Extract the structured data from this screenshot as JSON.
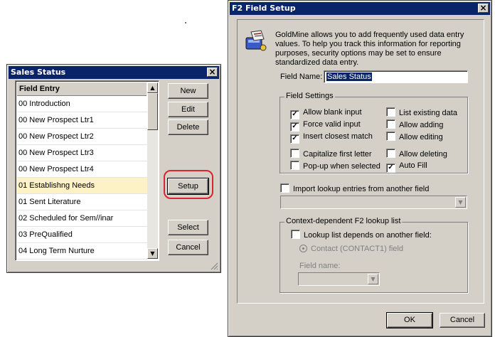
{
  "sales_status": {
    "title": "Sales Status",
    "list_header": "Field Entry",
    "items": [
      {
        "label": "00 Introduction"
      },
      {
        "label": "00 New Prospect Ltr1"
      },
      {
        "label": "00 New Prospect Ltr2"
      },
      {
        "label": "00 New Prospect Ltr3"
      },
      {
        "label": "00 New Prospect Ltr4"
      },
      {
        "label": "01 Establishng Needs"
      },
      {
        "label": "01 Sent Literature"
      },
      {
        "label": "02 Scheduled for Sem//inar"
      },
      {
        "label": "03 PreQualified"
      },
      {
        "label": "04 Long Term Nurture"
      }
    ],
    "selected_index": 5,
    "buttons": {
      "new": "New",
      "edit": "Edit",
      "delete": "Delete",
      "setup": "Setup",
      "select": "Select",
      "cancel": "Cancel"
    }
  },
  "f2_setup": {
    "title": "F2 Field Setup",
    "description": "GoldMine allows you to add frequently used data entry values.  To help you track this information for reporting purposes, security options may be set to ensure standardized data entry.",
    "field_name_label": "Field Name:",
    "field_name_value": "Sales Status",
    "field_settings_title": "Field Settings",
    "settings_left": [
      {
        "label": "Allow blank input",
        "checked": true
      },
      {
        "label": "Force valid input",
        "checked": true
      },
      {
        "label": "Insert closest match",
        "checked": true
      },
      {
        "label": "Capitalize first letter",
        "checked": false
      },
      {
        "label": "Pop-up when selected",
        "checked": false
      }
    ],
    "settings_right": [
      {
        "label": "List existing data",
        "checked": false
      },
      {
        "label": "Allow adding",
        "checked": false
      },
      {
        "label": "Allow editing",
        "checked": false
      },
      {
        "label": "Allow deleting",
        "checked": false
      },
      {
        "label": "Auto Fill",
        "checked": true
      }
    ],
    "import_label": "Import lookup entries from another field",
    "context_title": "Context-dependent F2 lookup list",
    "depends_label": "Lookup list depends on another field:",
    "contact_radio_label": "Contact (CONTACT1) field",
    "field_name_label2": "Field name:",
    "ok": "OK",
    "cancel": "Cancel"
  },
  "colors": {
    "title_bar": "#0a246a",
    "selected_row": "#fdf2c6",
    "highlight_ring": "#d9262c"
  },
  "icons": [
    "close-icon",
    "scroll-up-arrow-icon",
    "scroll-down-arrow-icon",
    "checkmark-icon",
    "dropdown-arrow-icon",
    "resize-grip-icon",
    "goldmine-setup-icon"
  ]
}
